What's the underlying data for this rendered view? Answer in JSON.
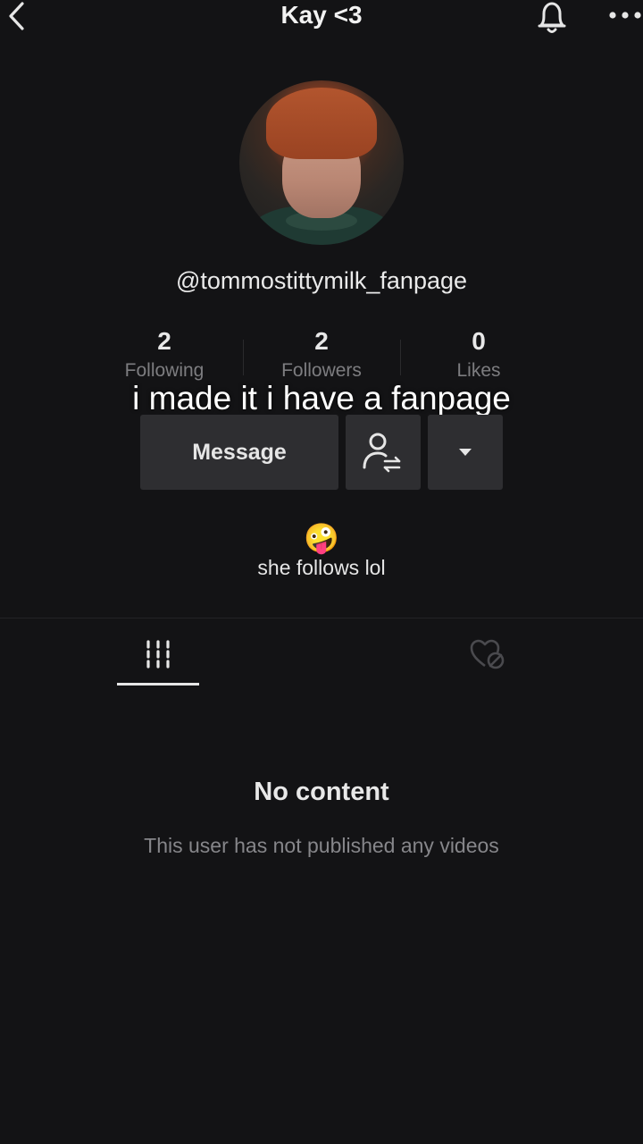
{
  "header": {
    "title": "Kay <3",
    "back_icon": "chevron-left-icon",
    "bell_icon": "bell-icon",
    "more_icon": "more-horizontal-icon"
  },
  "profile": {
    "username": "@tommostittymilk_fanpage",
    "stats": [
      {
        "value": "2",
        "label": "Following"
      },
      {
        "value": "2",
        "label": "Followers"
      },
      {
        "value": "0",
        "label": "Likes"
      }
    ],
    "bio_emoji": "🤪",
    "bio": "she follows lol"
  },
  "overlay_caption": "i made it i have a fanpage",
  "actions": {
    "message_label": "Message",
    "friend_icon": "follow-back-icon",
    "dropdown_icon": "caret-down-icon"
  },
  "tabs": [
    {
      "name": "videos",
      "icon": "grid-icon",
      "active": true
    },
    {
      "name": "liked",
      "icon": "hidden-heart-icon",
      "active": false
    }
  ],
  "empty_state": {
    "title": "No content",
    "subtitle": "This user has not published any videos"
  },
  "colors": {
    "background": "#131315",
    "button": "#2e2e31",
    "muted_text": "#7d7d80"
  }
}
